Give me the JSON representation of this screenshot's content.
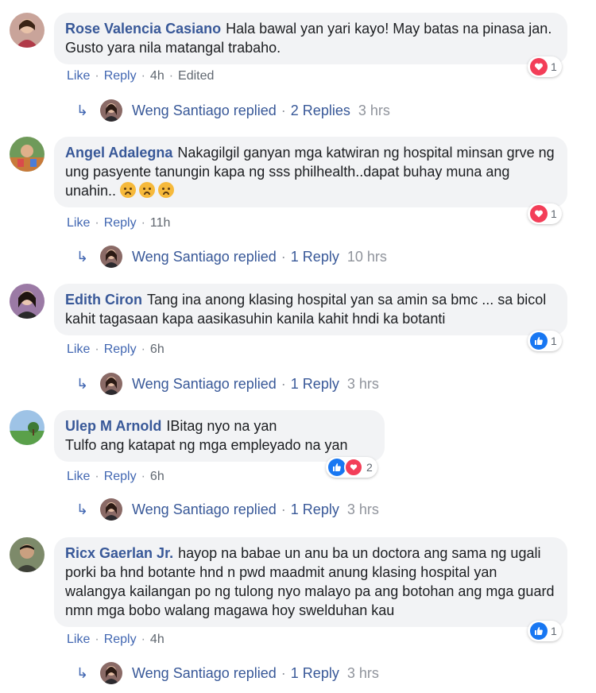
{
  "comments": [
    {
      "author": "Rose Valencia Casiano",
      "text": "Hala bawal yan yari kayo! May batas na pinasa jan. Gusto yara nila matangal trabaho.",
      "actions": {
        "like": "Like",
        "reply": "Reply",
        "time": "4h",
        "edited": "Edited"
      },
      "reaction": {
        "icons": [
          "love"
        ],
        "count": "1"
      },
      "reply_summary": {
        "name": "Weng Santiago replied",
        "count": "2 Replies",
        "time": "3 hrs"
      }
    },
    {
      "author": "Angel Adalegna",
      "text": "Nakagilgil ganyan mga katwiran ng hospital minsan grve ng ung pasyente tanungin kapa ng sss philhealth..dapat buhay muna ang unahin..",
      "emojis": [
        "frowning-face",
        "frowning-face",
        "frowning-face"
      ],
      "actions": {
        "like": "Like",
        "reply": "Reply",
        "time": "11h"
      },
      "reaction": {
        "icons": [
          "love"
        ],
        "count": "1"
      },
      "reply_summary": {
        "name": "Weng Santiago replied",
        "count": "1 Reply",
        "time": "10 hrs"
      }
    },
    {
      "author": "Edith Ciron",
      "text": "Tang ina anong klasing hospital yan sa amin sa bmc ... sa bicol kahit tagasaan kapa aasikasuhin kanila kahit hndi ka botanti",
      "actions": {
        "like": "Like",
        "reply": "Reply",
        "time": "6h"
      },
      "reaction": {
        "icons": [
          "like"
        ],
        "count": "1"
      },
      "reply_summary": {
        "name": "Weng Santiago replied",
        "count": "1 Reply",
        "time": "3 hrs"
      }
    },
    {
      "author": "Ulep M Arnold",
      "text_line1": "IBitag nyo na yan",
      "text_line2": "Tulfo ang katapat ng mga empleyado na yan",
      "actions": {
        "like": "Like",
        "reply": "Reply",
        "time": "6h"
      },
      "reaction": {
        "icons": [
          "like",
          "love"
        ],
        "count": "2"
      },
      "reply_summary": {
        "name": "Weng Santiago replied",
        "count": "1 Reply",
        "time": "3 hrs"
      }
    },
    {
      "author": "Ricx Gaerlan Jr.",
      "text": "hayop na babae un anu ba un doctora ang sama ng ugali porki ba hnd botante hnd n pwd maadmit anung klasing hospital yan walangya kailangan po ng tulong nyo malayo pa ang botohan ang mga guard nmn mga bobo walang magawa hoy swelduhan kau",
      "actions": {
        "like": "Like",
        "reply": "Reply",
        "time": "4h"
      },
      "reaction": {
        "icons": [
          "like"
        ],
        "count": "1"
      },
      "reply_summary": {
        "name": "Weng Santiago replied",
        "count": "1 Reply",
        "time": "3 hrs"
      }
    }
  ],
  "colors": {
    "link": "#385898",
    "action": "#4267b2",
    "bubble": "#f2f3f5",
    "love": "#f33e58",
    "like": "#1877f2"
  },
  "icons": {
    "reply_arrow": "reply-arrow-icon",
    "love": "heart-icon",
    "like": "thumbs-up-icon"
  }
}
